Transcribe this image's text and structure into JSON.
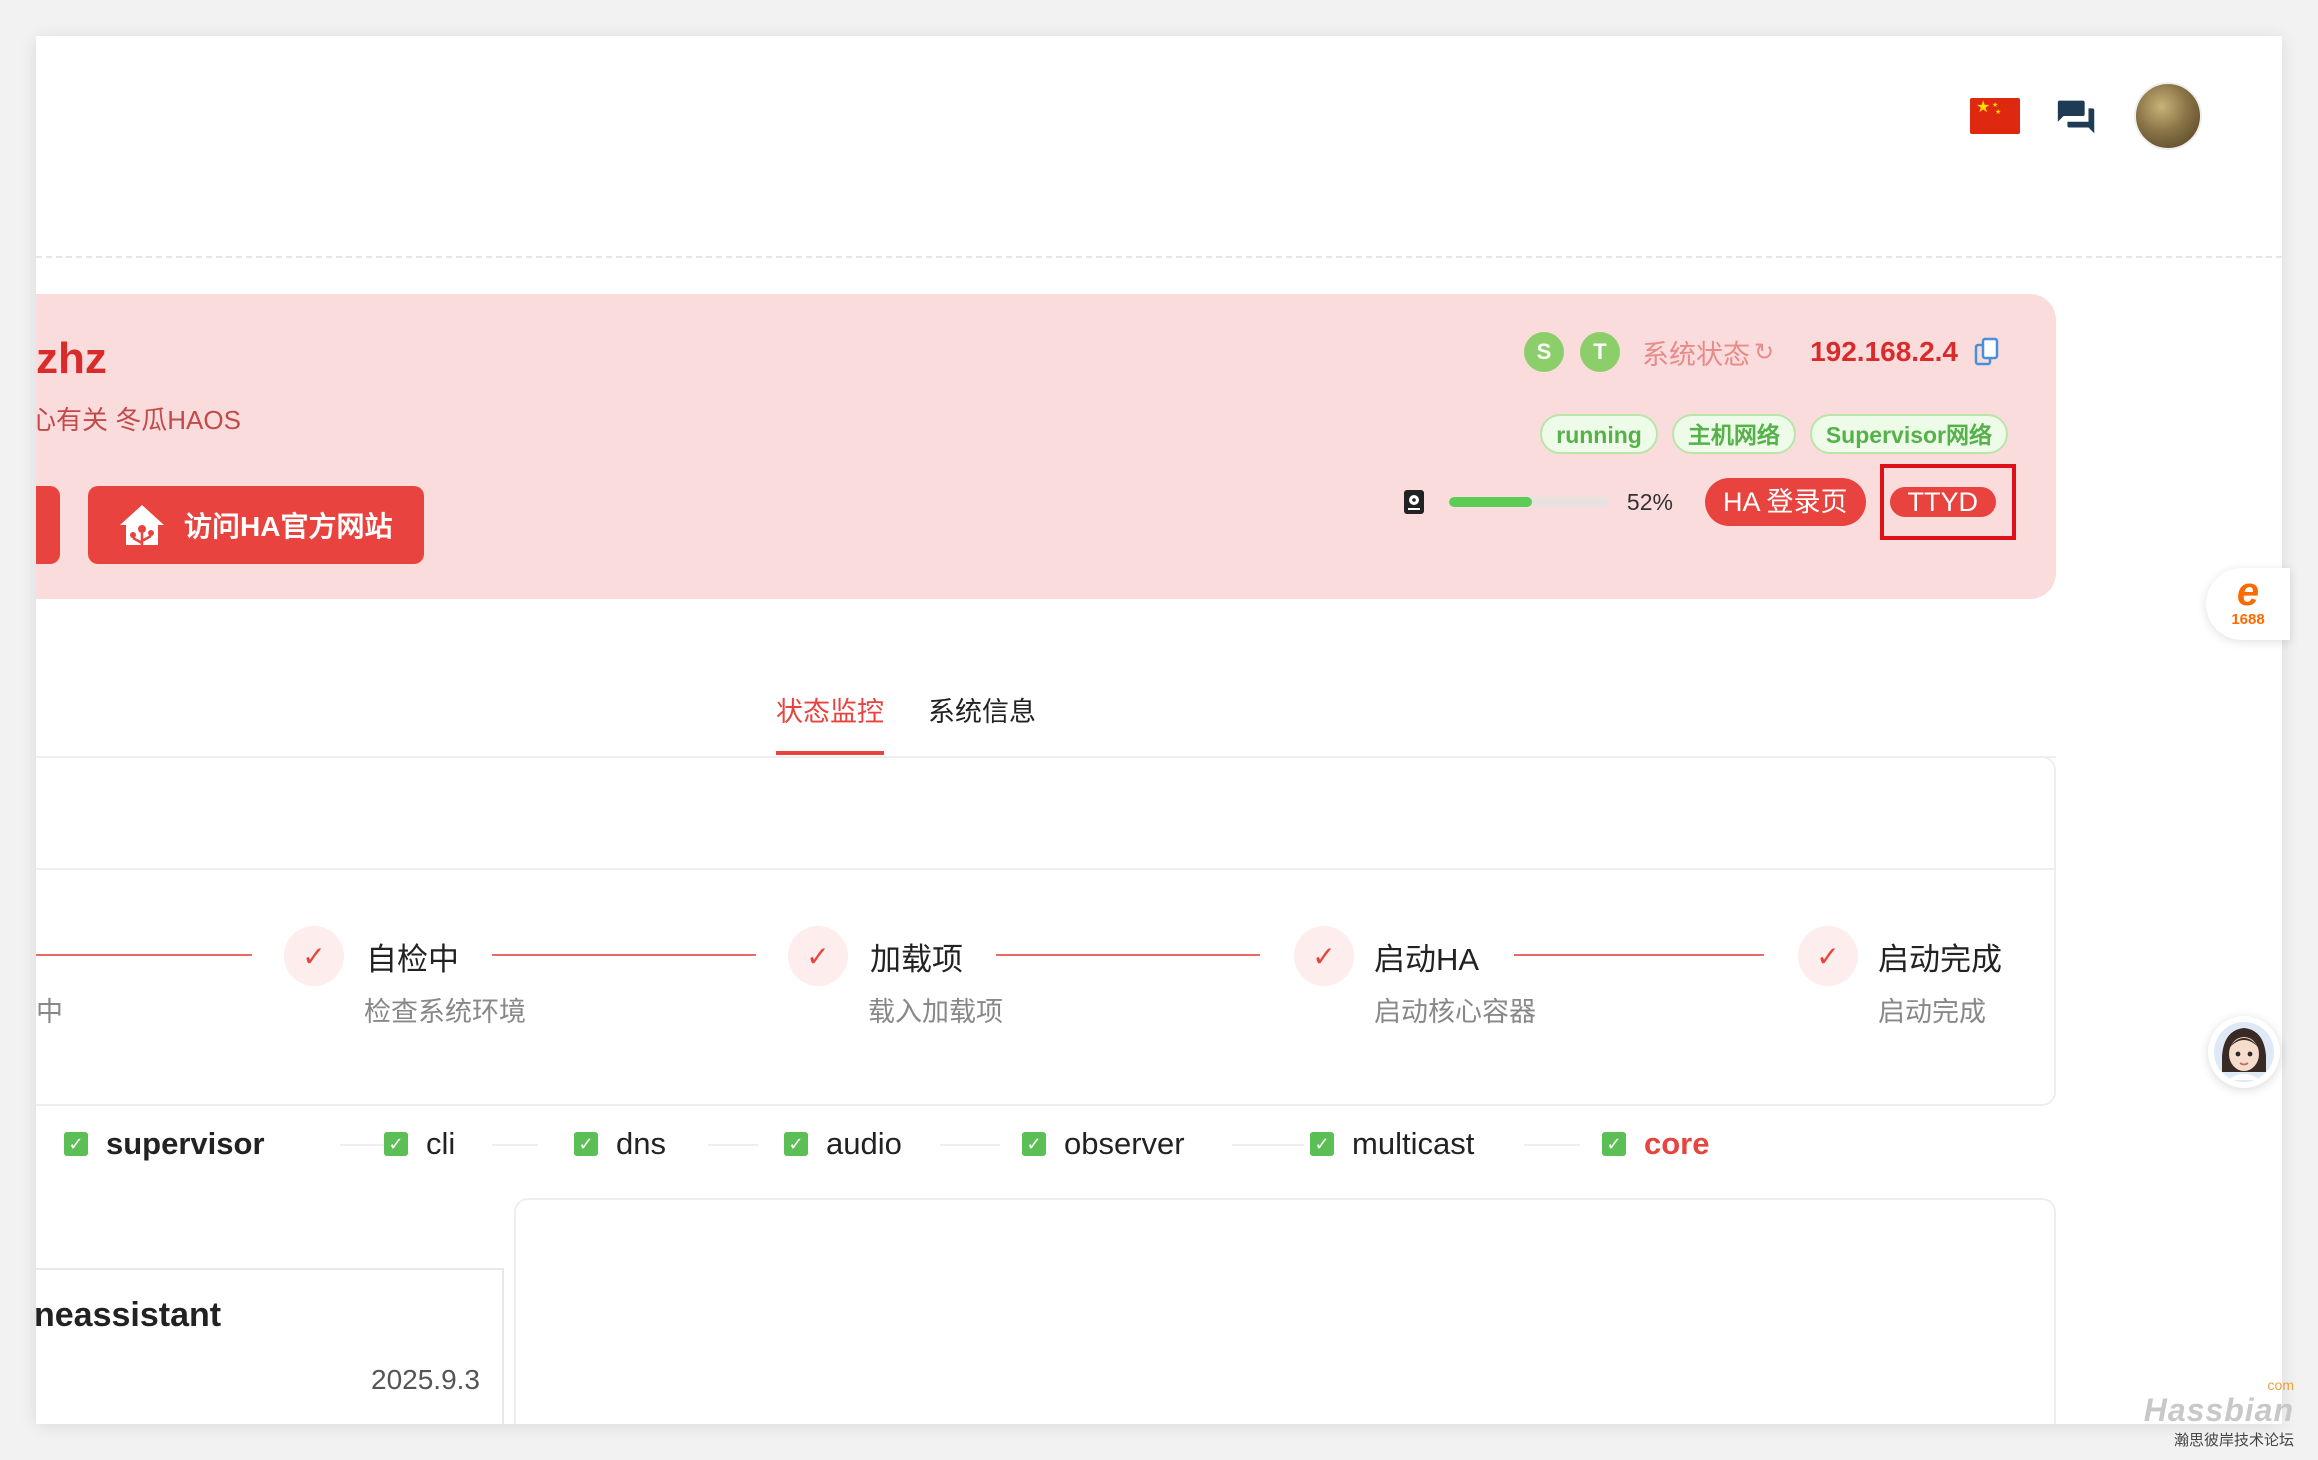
{
  "header": {
    "flag_icon": "china-flag-icon",
    "chat_icon": "chat-icon",
    "avatar_icon": "user-avatar"
  },
  "banner": {
    "title": "zhz",
    "subtitle": "心有关 冬瓜HAOS",
    "visit_button": "访问HA官方网站",
    "status_badges": [
      "S",
      "T"
    ],
    "system_status_label": "系统状态",
    "ip": "192.168.2.4",
    "tags": [
      "running",
      "主机网络",
      "Supervisor网络"
    ],
    "disk_usage_percent": 52,
    "disk_usage_label": "52%",
    "ha_login_button": "HA 登录页",
    "ttyd_button": "TTYD",
    "accent_color": "#e8433e",
    "banner_bg": "#fbdcdc"
  },
  "tabs": [
    {
      "label": "状态监控",
      "active": true
    },
    {
      "label": "系统信息",
      "active": false
    }
  ],
  "steps": [
    {
      "title": "",
      "desc": "中"
    },
    {
      "title": "自检中",
      "desc": "检查系统环境"
    },
    {
      "title": "加载项",
      "desc": "载入加载项"
    },
    {
      "title": "启动HA",
      "desc": "启动核心容器"
    },
    {
      "title": "启动完成",
      "desc": "启动完成"
    }
  ],
  "services": [
    "supervisor",
    "cli",
    "dns",
    "audio",
    "observer",
    "multicast",
    "core"
  ],
  "container": {
    "name": "neassistant",
    "version": "2025.9.3"
  },
  "float": {
    "badge_1688": "1688"
  },
  "watermark": {
    "com": "com",
    "brand": "Hassbian",
    "tagline": "瀚思彼岸技术论坛"
  }
}
